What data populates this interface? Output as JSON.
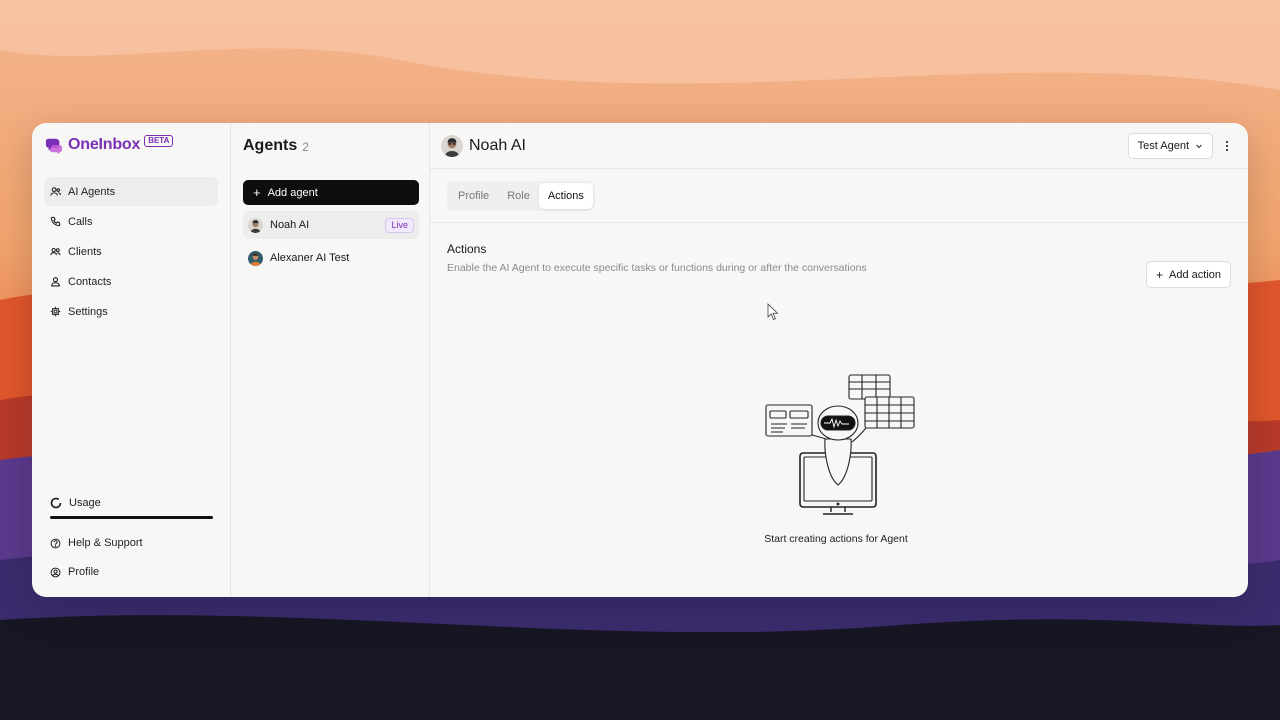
{
  "brand": {
    "name": "OneInbox",
    "badge": "BETA"
  },
  "nav": {
    "items": [
      {
        "label": "AI Agents",
        "icon": "users-icon",
        "active": true
      },
      {
        "label": "Calls",
        "icon": "phone-icon"
      },
      {
        "label": "Clients",
        "icon": "clients-icon"
      },
      {
        "label": "Contacts",
        "icon": "contact-icon"
      },
      {
        "label": "Settings",
        "icon": "gear-icon"
      }
    ],
    "usage": "Usage",
    "help": "Help & Support",
    "profile": "Profile"
  },
  "agents": {
    "title": "Agents",
    "count": "2",
    "add_label": "Add agent",
    "list": [
      {
        "name": "Noah AI",
        "status": "Live"
      },
      {
        "name": "Alexaner AI Test"
      }
    ]
  },
  "main": {
    "title": "Noah AI",
    "test_agent_label": "Test Agent",
    "tabs": [
      {
        "label": "Profile"
      },
      {
        "label": "Role"
      },
      {
        "label": "Actions",
        "active": true
      }
    ],
    "section_title": "Actions",
    "section_desc": "Enable the AI Agent to execute specific tasks or functions during or after the conversations",
    "add_action_label": "Add action",
    "empty_text": "Start creating actions for Agent"
  },
  "colors": {
    "brand": "#7a2fb5",
    "primary_button": "#0e0e0e"
  }
}
